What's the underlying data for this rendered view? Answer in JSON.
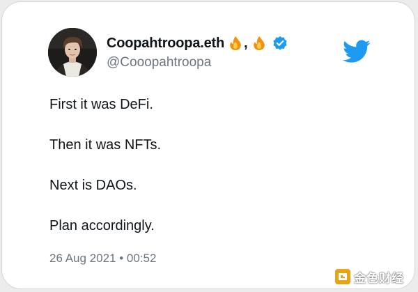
{
  "user": {
    "display_name": "Coopahtroopa.eth",
    "name_separator": ",",
    "handle": "@Cooopahtroopa",
    "name_emojis": [
      "fire-emoji",
      "fire-emoji"
    ],
    "verified_icon": "verified-badge-icon"
  },
  "tweet": {
    "lines": [
      "First it was DeFi.",
      "Then it was NFTs.",
      "Next is DAOs.",
      "Plan accordingly."
    ],
    "timestamp": "26 Aug 2021 • 00:52"
  },
  "branding": {
    "logo_icon": "twitter-bird-icon",
    "logo_color": "#1d9bf0"
  },
  "watermark": {
    "text": "金色财经",
    "logo_color": "#e8a317"
  },
  "colors": {
    "text_primary": "#0f1419",
    "text_secondary": "#6c7680",
    "verified": "#1d9bf0"
  }
}
